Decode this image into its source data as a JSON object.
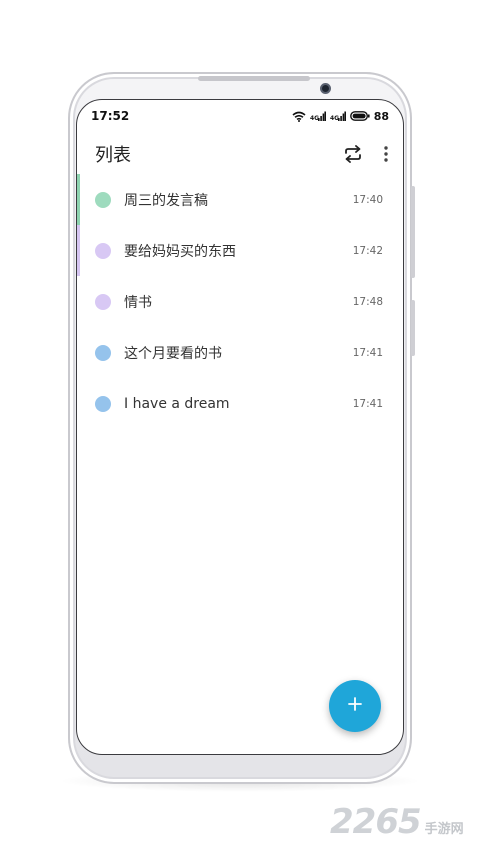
{
  "status_bar": {
    "time": "17:52",
    "battery": "88"
  },
  "header": {
    "title": "列表",
    "actions": {
      "sync_icon": "repeat-icon",
      "menu_icon": "more-vertical-icon"
    }
  },
  "notes": [
    {
      "title": "周三的发言稿",
      "time": "17:40",
      "color": "#9edbbe",
      "bar_color": "#8fd4b1"
    },
    {
      "title": "要给妈妈买的东西",
      "time": "17:42",
      "color": "#d8c8f4",
      "bar_color": "#d6c6f2"
    },
    {
      "title": "情书",
      "time": "17:48",
      "color": "#d8c8f4",
      "bar_color": ""
    },
    {
      "title": "这个月要看的书",
      "time": "17:41",
      "color": "#95c3ec",
      "bar_color": ""
    },
    {
      "title": "I have a dream",
      "time": "17:41",
      "color": "#95c3ec",
      "bar_color": ""
    }
  ],
  "fab": {
    "icon": "plus-icon",
    "color": "#1fa6d9"
  },
  "watermark": {
    "number": "2265",
    "text": "手游网"
  }
}
